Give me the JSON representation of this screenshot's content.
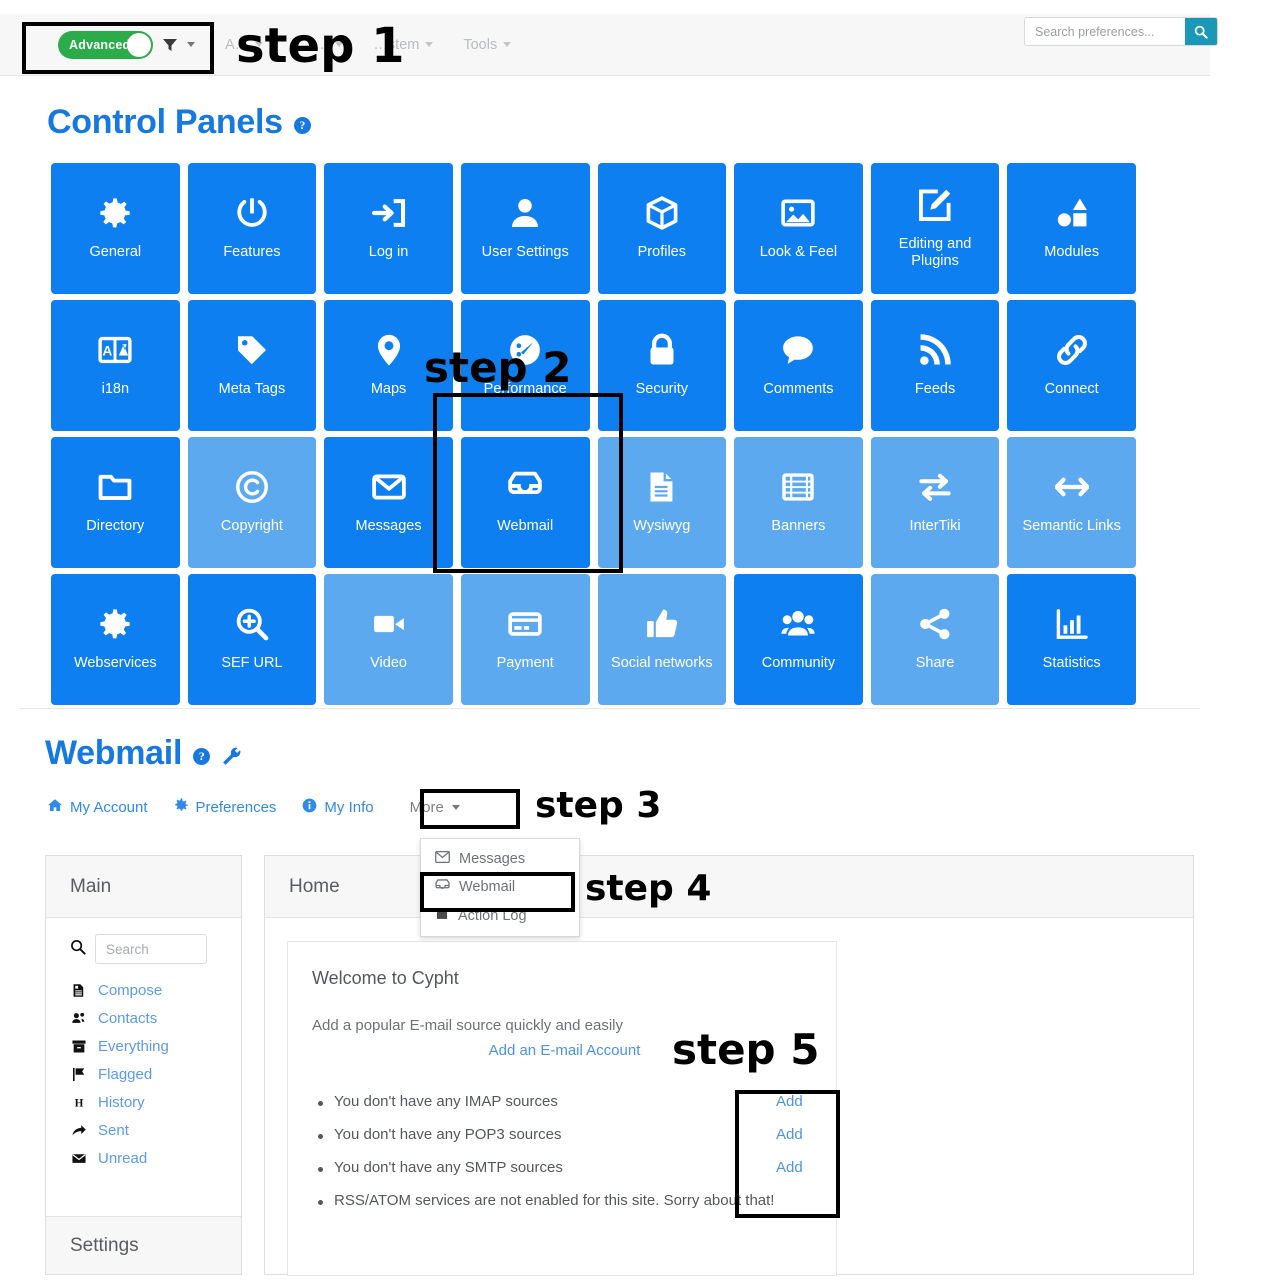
{
  "topbar": {
    "advanced_toggle_label": "Advanced",
    "filter_icon": "funnel-icon",
    "menu": [
      {
        "label": "A…",
        "icon": "chevron-down-icon"
      },
      {
        "label": "…s…",
        "icon": "chevron-down-icon"
      },
      {
        "label": "…stem",
        "icon": "chevron-down-icon"
      },
      {
        "label": "Tools",
        "icon": "chevron-down-icon"
      }
    ],
    "search": {
      "placeholder": "Search preferences...",
      "value": "",
      "button_icon": "search-icon",
      "button_color": "#1b98b7"
    }
  },
  "control_panels": {
    "title": "Control Panels",
    "help_icon": "help-circle-icon",
    "active_color": "#0d7ff0",
    "inactive_color": "#5da9f0",
    "tiles": [
      {
        "label": "General",
        "icon": "gear-icon",
        "state": "active"
      },
      {
        "label": "Features",
        "icon": "power-icon",
        "state": "active"
      },
      {
        "label": "Log in",
        "icon": "sign-in-icon",
        "state": "active"
      },
      {
        "label": "User Settings",
        "icon": "user-icon",
        "state": "active"
      },
      {
        "label": "Profiles",
        "icon": "cube-icon",
        "state": "active"
      },
      {
        "label": "Look & Feel",
        "icon": "image-icon",
        "state": "active"
      },
      {
        "label": "Editing and Plugins",
        "icon": "edit-square-icon",
        "state": "active"
      },
      {
        "label": "Modules",
        "icon": "shapes-icon",
        "state": "active"
      },
      {
        "label": "i18n",
        "icon": "language-icon",
        "state": "active"
      },
      {
        "label": "Meta Tags",
        "icon": "tag-icon",
        "state": "active"
      },
      {
        "label": "Maps",
        "icon": "map-pin-icon",
        "state": "active"
      },
      {
        "label": "Performance",
        "icon": "gauge-icon",
        "state": "active"
      },
      {
        "label": "Security",
        "icon": "lock-icon",
        "state": "active"
      },
      {
        "label": "Comments",
        "icon": "comment-icon",
        "state": "active"
      },
      {
        "label": "Feeds",
        "icon": "rss-icon",
        "state": "active"
      },
      {
        "label": "Connect",
        "icon": "link-icon",
        "state": "active"
      },
      {
        "label": "Directory",
        "icon": "folder-icon",
        "state": "active"
      },
      {
        "label": "Copyright",
        "icon": "copyright-icon",
        "state": "inactive"
      },
      {
        "label": "Messages",
        "icon": "envelope-icon",
        "state": "active"
      },
      {
        "label": "Webmail",
        "icon": "inbox-icon",
        "state": "active"
      },
      {
        "label": "Wysiwyg",
        "icon": "document-icon",
        "state": "inactive"
      },
      {
        "label": "Banners",
        "icon": "film-icon",
        "state": "inactive"
      },
      {
        "label": "InterTiki",
        "icon": "exchange-icon",
        "state": "inactive"
      },
      {
        "label": "Semantic Links",
        "icon": "arrows-h-icon",
        "state": "inactive"
      },
      {
        "label": "Webservices",
        "icon": "gear-icon",
        "state": "active"
      },
      {
        "label": "SEF URL",
        "icon": "search-plus-icon",
        "state": "active"
      },
      {
        "label": "Video",
        "icon": "video-icon",
        "state": "inactive"
      },
      {
        "label": "Payment",
        "icon": "credit-card-icon",
        "state": "inactive"
      },
      {
        "label": "Social networks",
        "icon": "thumbs-up-icon",
        "state": "inactive"
      },
      {
        "label": "Community",
        "icon": "users-icon",
        "state": "active"
      },
      {
        "label": "Share",
        "icon": "share-icon",
        "state": "inactive"
      },
      {
        "label": "Statistics",
        "icon": "chart-bar-icon",
        "state": "active"
      }
    ]
  },
  "webmail": {
    "title": "Webmail",
    "help_icon": "help-circle-icon",
    "wrench_icon": "wrench-icon",
    "nav": [
      {
        "label": "My Account",
        "icon": "home-icon"
      },
      {
        "label": "Preferences",
        "icon": "gear-icon"
      },
      {
        "label": "My Info",
        "icon": "info-icon"
      },
      {
        "label": "More",
        "icon": "caret-down-icon"
      }
    ],
    "dropdown": [
      {
        "label": "Messages",
        "icon": "envelope-icon"
      },
      {
        "label": "Webmail",
        "icon": "inbox-icon"
      },
      {
        "label": "Action Log",
        "icon": "archive-icon"
      }
    ]
  },
  "sidebar": {
    "header": "Main",
    "footer": "Settings",
    "search": {
      "placeholder": "Search",
      "value": "",
      "icon": "search-icon"
    },
    "items": [
      {
        "label": "Compose",
        "icon": "compose-icon"
      },
      {
        "label": "Contacts",
        "icon": "contacts-icon"
      },
      {
        "label": "Everything",
        "icon": "archive-icon"
      },
      {
        "label": "Flagged",
        "icon": "flag-icon"
      },
      {
        "label": "History",
        "icon": "history-h-icon"
      },
      {
        "label": "Sent",
        "icon": "share-arrow-icon"
      },
      {
        "label": "Unread",
        "icon": "envelope-icon"
      }
    ]
  },
  "content": {
    "header": "Home",
    "welcome": "Welcome to Cypht",
    "subtitle": "Add a popular E-mail source quickly and easily",
    "add_account_link": "Add an E-mail Account",
    "bullets": [
      {
        "text": "You don't have any IMAP sources",
        "action": "Add"
      },
      {
        "text": "You don't have any POP3 sources",
        "action": "Add"
      },
      {
        "text": "You don't have any SMTP sources",
        "action": "Add"
      },
      {
        "text": "RSS/ATOM services are not enabled for this site. Sorry about that!",
        "action": ""
      }
    ]
  },
  "annotations": {
    "step1": "step 1",
    "step2": "step 2",
    "step3": "step 3",
    "step4": "step 4",
    "step5": "step 5"
  }
}
